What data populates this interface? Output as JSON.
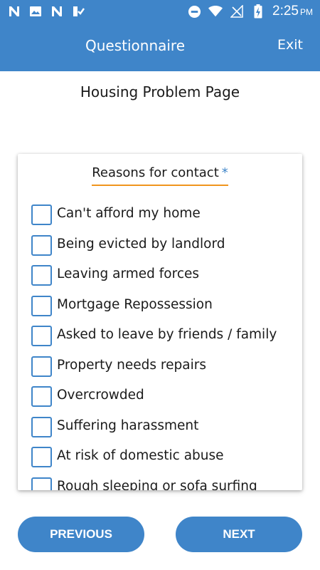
{
  "status_bar": {
    "time": "2:25",
    "ampm": "PM",
    "left_icons": [
      "n-notification-icon",
      "image-notification-icon",
      "n-notification-icon",
      "checklist-notification-icon"
    ],
    "right_icons": [
      "do-not-disturb-icon",
      "wifi-icon",
      "no-signal-icon",
      "battery-charging-icon"
    ]
  },
  "app_bar": {
    "title": "Questionnaire",
    "exit_label": "Exit"
  },
  "page_title": "Housing Problem Page",
  "card": {
    "heading": "Reasons for contact",
    "required_marker": "*",
    "options": [
      {
        "label": "Can't afford my home",
        "checked": false
      },
      {
        "label": "Being evicted by landlord",
        "checked": false
      },
      {
        "label": "Leaving armed forces",
        "checked": false
      },
      {
        "label": "Mortgage Repossession",
        "checked": false
      },
      {
        "label": "Asked to leave by friends / family",
        "checked": false
      },
      {
        "label": "Property needs repairs",
        "checked": false
      },
      {
        "label": "Overcrowded",
        "checked": false
      },
      {
        "label": "Suffering harassment",
        "checked": false
      },
      {
        "label": "At risk of domestic abuse",
        "checked": false
      },
      {
        "label": "Rough sleeping or sofa surfing",
        "checked": false
      }
    ]
  },
  "buttons": {
    "previous": "PREVIOUS",
    "next": "NEXT"
  },
  "colors": {
    "primary": "#3f85c9",
    "accent_underline": "#f0951e"
  }
}
